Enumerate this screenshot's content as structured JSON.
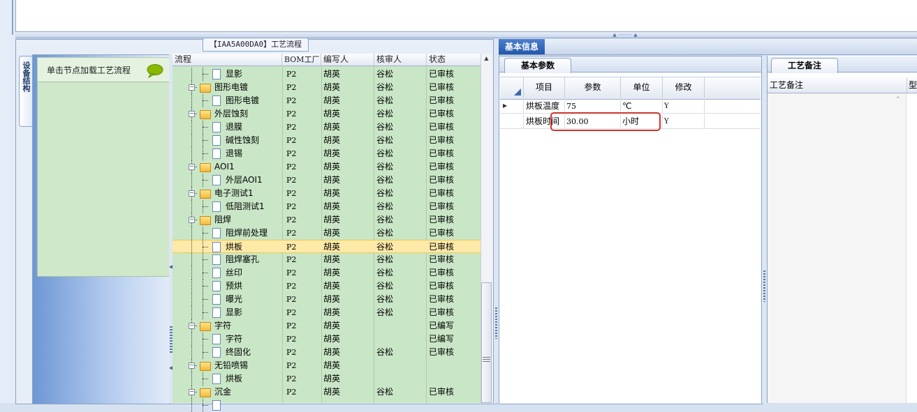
{
  "tree_panel": {
    "title": "【IAA5A00DA0】工艺流程",
    "side_tab": "设备结构",
    "nav_hint": "单击节点加载工艺流程",
    "columns": [
      "流程",
      "BOM工厂",
      "编写人",
      "核审人",
      "状态"
    ],
    "rows": [
      {
        "level": 2,
        "type": "doc",
        "name": "显影",
        "bom": "P2",
        "writer": "胡英",
        "reviewer": "谷松",
        "status": "已审核"
      },
      {
        "level": 1,
        "type": "folder",
        "name": "图形电镀",
        "bom": "P2",
        "writer": "胡英",
        "reviewer": "谷松",
        "status": "已审核"
      },
      {
        "level": 2,
        "type": "doc",
        "name": "图形电镀",
        "bom": "P2",
        "writer": "胡英",
        "reviewer": "谷松",
        "status": "已审核"
      },
      {
        "level": 1,
        "type": "folder",
        "name": "外层蚀刻",
        "bom": "P2",
        "writer": "胡英",
        "reviewer": "谷松",
        "status": "已审核"
      },
      {
        "level": 2,
        "type": "doc",
        "name": "退膜",
        "bom": "P2",
        "writer": "胡英",
        "reviewer": "谷松",
        "status": "已审核"
      },
      {
        "level": 2,
        "type": "doc",
        "name": "碱性蚀刻",
        "bom": "P2",
        "writer": "胡英",
        "reviewer": "谷松",
        "status": "已审核"
      },
      {
        "level": 2,
        "type": "doc",
        "name": "退锡",
        "bom": "P2",
        "writer": "胡英",
        "reviewer": "谷松",
        "status": "已审核"
      },
      {
        "level": 1,
        "type": "folder",
        "name": "AOI1",
        "bom": "P2",
        "writer": "胡英",
        "reviewer": "谷松",
        "status": "已审核"
      },
      {
        "level": 2,
        "type": "doc",
        "name": "外层AOI1",
        "bom": "P2",
        "writer": "胡英",
        "reviewer": "谷松",
        "status": "已审核"
      },
      {
        "level": 1,
        "type": "folder",
        "name": "电子测试1",
        "bom": "P2",
        "writer": "胡英",
        "reviewer": "谷松",
        "status": "已审核"
      },
      {
        "level": 2,
        "type": "doc",
        "name": "低阻测试1",
        "bom": "P2",
        "writer": "胡英",
        "reviewer": "谷松",
        "status": "已审核"
      },
      {
        "level": 1,
        "type": "folder",
        "name": "阻焊",
        "bom": "P2",
        "writer": "胡英",
        "reviewer": "谷松",
        "status": "已审核"
      },
      {
        "level": 2,
        "type": "doc",
        "name": "阻焊前处理",
        "bom": "P2",
        "writer": "胡英",
        "reviewer": "谷松",
        "status": "已审核"
      },
      {
        "level": 2,
        "type": "doc",
        "name": "烘板",
        "bom": "P2",
        "writer": "胡英",
        "reviewer": "谷松",
        "status": "已审核",
        "selected": true
      },
      {
        "level": 2,
        "type": "doc",
        "name": "阻焊塞孔",
        "bom": "P2",
        "writer": "胡英",
        "reviewer": "谷松",
        "status": "已审核"
      },
      {
        "level": 2,
        "type": "doc",
        "name": "丝印",
        "bom": "P2",
        "writer": "胡英",
        "reviewer": "谷松",
        "status": "已审核"
      },
      {
        "level": 2,
        "type": "doc",
        "name": "预烘",
        "bom": "P2",
        "writer": "胡英",
        "reviewer": "谷松",
        "status": "已审核"
      },
      {
        "level": 2,
        "type": "doc",
        "name": "曝光",
        "bom": "P2",
        "writer": "胡英",
        "reviewer": "谷松",
        "status": "已审核"
      },
      {
        "level": 2,
        "type": "doc",
        "name": "显影",
        "bom": "P2",
        "writer": "胡英",
        "reviewer": "谷松",
        "status": "已审核"
      },
      {
        "level": 1,
        "type": "folder",
        "name": "字符",
        "bom": "P2",
        "writer": "胡英",
        "reviewer": "",
        "status": "已编写"
      },
      {
        "level": 2,
        "type": "doc",
        "name": "字符",
        "bom": "P2",
        "writer": "胡英",
        "reviewer": "",
        "status": "已编写"
      },
      {
        "level": 2,
        "type": "doc",
        "name": "终固化",
        "bom": "P2",
        "writer": "胡英",
        "reviewer": "谷松",
        "status": "已审核"
      },
      {
        "level": 1,
        "type": "folder",
        "name": "无铅喷锡",
        "bom": "P2",
        "writer": "胡英",
        "reviewer": "",
        "status": ""
      },
      {
        "level": 2,
        "type": "doc",
        "name": "烘板",
        "bom": "P2",
        "writer": "胡英",
        "reviewer": "",
        "status": ""
      },
      {
        "level": 1,
        "type": "folder",
        "name": "沉金",
        "bom": "P2",
        "writer": "胡英",
        "reviewer": "谷松",
        "status": "已审核"
      },
      {
        "level": 2,
        "type": "doc",
        "name": "",
        "bom": "",
        "writer": "",
        "reviewer": "",
        "status": ""
      }
    ]
  },
  "info_panel": {
    "main_tab": "基本信息",
    "params_tab": "基本参数",
    "param_columns": [
      "项目",
      "参数",
      "单位",
      "修改"
    ],
    "param_rows": [
      {
        "item": "烘板温度",
        "value": "75",
        "unit": "℃",
        "modify": "Y"
      },
      {
        "item": "烘板时间",
        "value": "30.00",
        "unit": "小时",
        "modify": "Y"
      }
    ]
  },
  "remark_panel": {
    "tab": "工艺备注",
    "col1": "工艺备注",
    "col2": "型"
  },
  "colors": {
    "grid_bg": "#c9e6c6",
    "selected_row": "#fde9a8",
    "accent_tab": "#2257ab",
    "highlight_box": "#d0342c"
  }
}
